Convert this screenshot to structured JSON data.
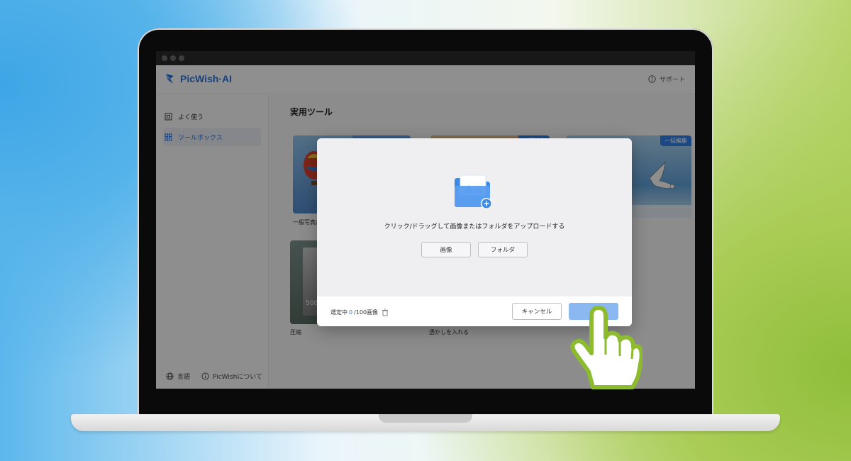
{
  "app": {
    "logo_text": "PicWish·AI",
    "support_label": "サポート"
  },
  "sidebar": {
    "items": [
      {
        "label": "よく使う",
        "icon": "frequent-icon"
      },
      {
        "label": "ツールボックス",
        "icon": "grid-icon"
      }
    ],
    "footer": {
      "language_label": "言語",
      "about_label": "PicWishについて"
    }
  },
  "main": {
    "title": "実用ツール",
    "cards": [
      {
        "label": "一般写真高",
        "badge": ""
      },
      {
        "label": "",
        "badge": "一括編集"
      },
      {
        "label": "",
        "badge": "一括編集"
      },
      {
        "label": "圧縮",
        "badge": "",
        "overlay_text": "500"
      },
      {
        "label": "透かしを入れる",
        "badge": ""
      }
    ]
  },
  "modal": {
    "upload_text": "クリック/ドラッグして画像またはフォルダをアップロードする",
    "image_button": "画像",
    "folder_button": "フォルダ",
    "selected_prefix": "選定中",
    "selected_count": "0",
    "selected_suffix": "/100画像",
    "cancel_button": "キャンセル",
    "confirm_button": ""
  },
  "colors": {
    "accent": "#2b6fd6",
    "primary_button": "#8cb8f2",
    "hand_outline": "#8dbb2e"
  }
}
